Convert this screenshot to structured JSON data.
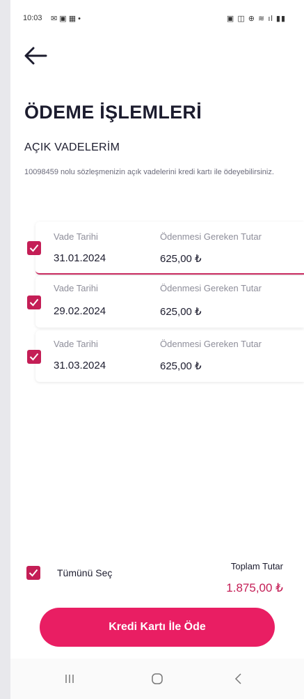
{
  "status_bar": {
    "time": "10:03",
    "notification_icons": "✉ ▣ ▦ •",
    "system_icons": "▣ ◫ ⊕ ≋ ıl ▮▮"
  },
  "page": {
    "title": "ÖDEME İŞLEMLERİ",
    "section_title": "AÇIK VADELERİM",
    "description": "10098459 nolu sözleşmenizin açık vadelerini kredi kartı ile ödeyebilirsiniz."
  },
  "installments": [
    {
      "due_date_label": "Vade Tarihi",
      "due_date": "31.01.2024",
      "amount_label": "Ödenmesi Gereken Tutar",
      "amount": "625,00 ₺",
      "checked": true
    },
    {
      "due_date_label": "Vade Tarihi",
      "due_date": "29.02.2024",
      "amount_label": "Ödenmesi Gereken Tutar",
      "amount": "625,00 ₺",
      "checked": true
    },
    {
      "due_date_label": "Vade Tarihi",
      "due_date": "31.03.2024",
      "amount_label": "Ödenmesi Gereken Tutar",
      "amount": "625,00 ₺",
      "checked": true
    }
  ],
  "footer": {
    "select_all_label": "Tümünü Seç",
    "select_all_checked": true,
    "total_label": "Toplam Tutar",
    "total_amount": "1.875,00 ₺",
    "pay_button_label": "Kredi Kartı İle Öde"
  },
  "colors": {
    "accent": "#e91e63",
    "checkbox": "#c41e56",
    "total": "#c41e56"
  },
  "icons": {
    "back": "arrow-left-icon",
    "check": "check-icon",
    "nav_recents": "recents-icon",
    "nav_home": "home-icon",
    "nav_back": "chevron-left-icon"
  }
}
